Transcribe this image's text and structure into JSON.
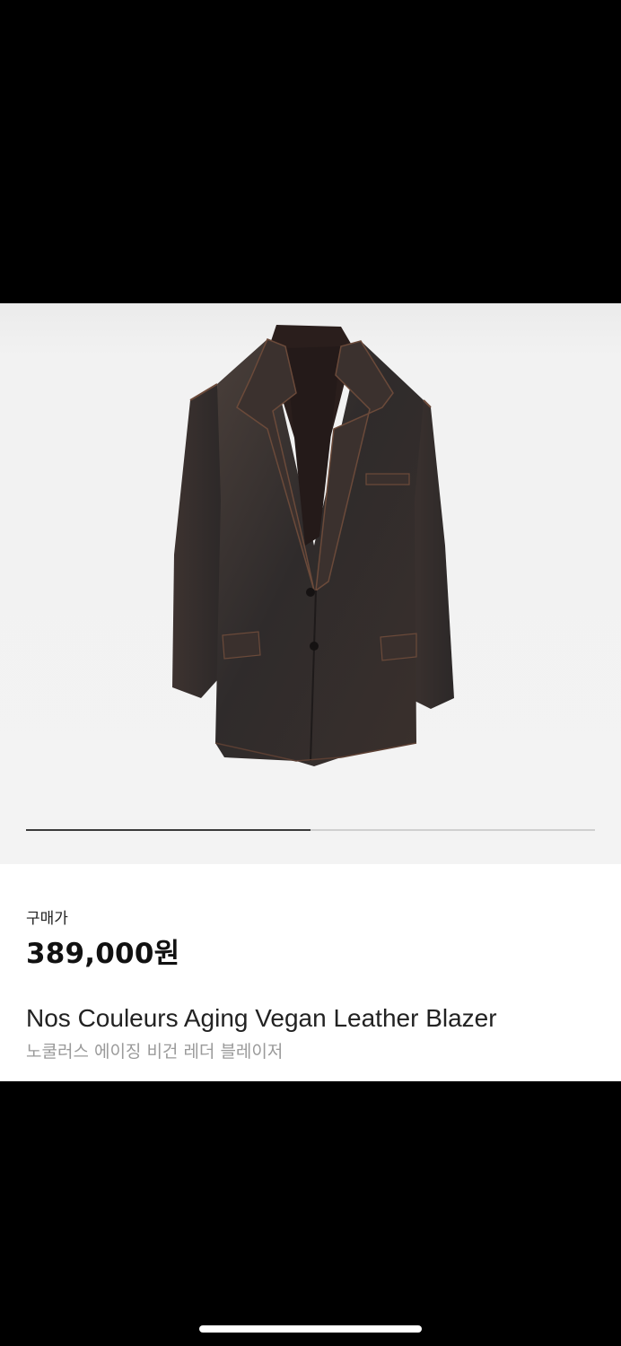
{
  "product": {
    "price_label": "구매가",
    "price": "389,000원",
    "name_en": "Nos Couleurs Aging Vegan Leather Blazer",
    "name_ko": "노쿨러스 에이징 비건 레더 블레이저",
    "image_icon": "blazer-photo"
  },
  "carousel": {
    "progress_fraction": 0.5
  },
  "colors": {
    "background": "#000000",
    "gallery_bg": "#f3f3f3",
    "indicator_active": "#3a3a3a",
    "indicator_track": "#cfcfcf"
  }
}
